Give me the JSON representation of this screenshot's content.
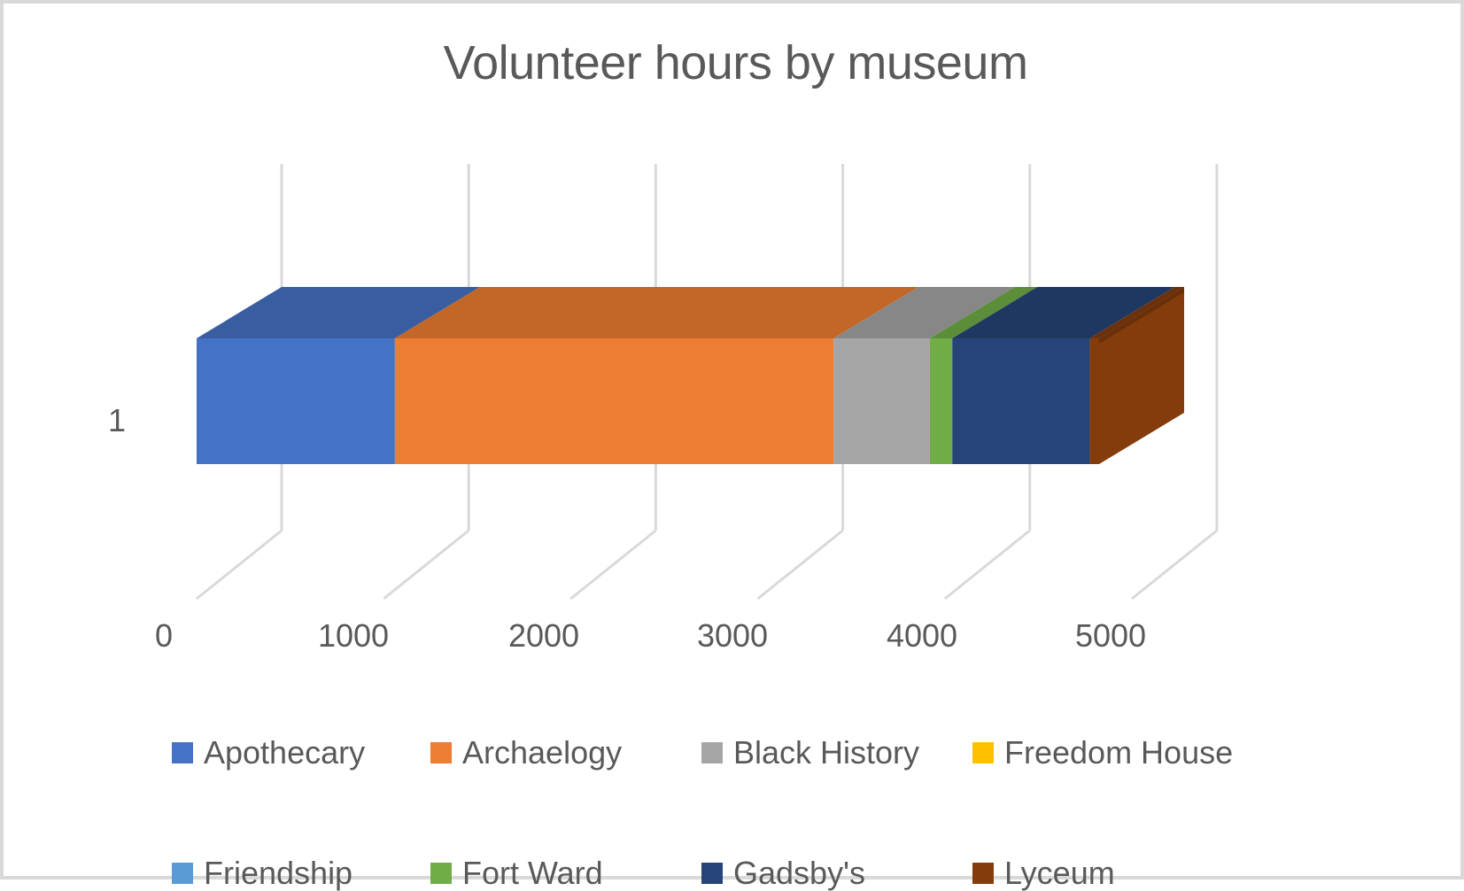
{
  "chart_data": {
    "type": "bar",
    "orientation": "horizontal",
    "stacked": true,
    "style": "3d",
    "title": "Volunteer hours by museum",
    "xlabel": "",
    "ylabel": "",
    "categories": [
      "1"
    ],
    "xlim": [
      0,
      5000
    ],
    "xticks": [
      0,
      1000,
      2000,
      3000,
      4000,
      5000
    ],
    "xticklabels": [
      "0",
      "1000",
      "2000",
      "3000",
      "4000",
      "5000"
    ],
    "grid": true,
    "grid_axis": "x",
    "legend_position": "bottom",
    "series": [
      {
        "name": "Apothecary",
        "values": [
          1060
        ],
        "color": "#4472C4"
      },
      {
        "name": "Archaelogy",
        "values": [
          2345
        ],
        "color": "#ED7D31"
      },
      {
        "name": "Black History",
        "values": [
          515
        ],
        "color": "#A5A5A5"
      },
      {
        "name": "Freedom House",
        "values": [
          0
        ],
        "color": "#FFC000"
      },
      {
        "name": "Friendship",
        "values": [
          0
        ],
        "color": "#5B9BD5"
      },
      {
        "name": "Fort Ward",
        "values": [
          120
        ],
        "color": "#70AD47"
      },
      {
        "name": "Gadsby's",
        "values": [
          735
        ],
        "color": "#264478"
      },
      {
        "name": "Lyceum",
        "values": [
          50
        ],
        "color": "#843C0C"
      }
    ]
  },
  "title": "Volunteer hours by museum",
  "axis": {
    "x_ticks": [
      {
        "label": "0",
        "x": 181
      },
      {
        "label": "1000",
        "x": 395
      },
      {
        "label": "2000",
        "x": 610
      },
      {
        "label": "3000",
        "x": 823
      },
      {
        "label": "4000",
        "x": 1037
      },
      {
        "label": "5000",
        "x": 1250
      }
    ],
    "category_labels": [
      "1"
    ]
  },
  "legend": {
    "rows": [
      [
        {
          "label": "Apothecary",
          "color": "#4472C4"
        },
        {
          "label": "Archaelogy",
          "color": "#ED7D31"
        },
        {
          "label": "Black History",
          "color": "#A5A5A5"
        },
        {
          "label": "Freedom House",
          "color": "#FFC000"
        }
      ],
      [
        {
          "label": "Friendship",
          "color": "#5B9BD5"
        },
        {
          "label": "Fort Ward",
          "color": "#70AD47"
        },
        {
          "label": "Gadsby's",
          "color": "#264478"
        },
        {
          "label": "Lyceum",
          "color": "#843C0C"
        }
      ]
    ]
  },
  "colors": {
    "title_text": "#595959",
    "axis_text": "#595959",
    "gridline": "#D9D9D9",
    "frame_border": "#D9D9D9",
    "background": "#FFFFFF"
  }
}
